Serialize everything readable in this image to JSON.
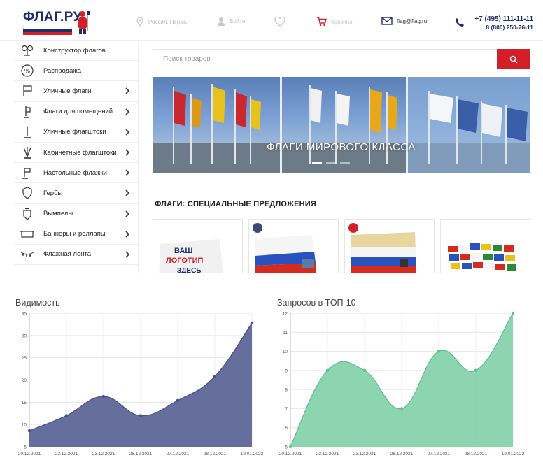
{
  "site": {
    "logo_text": "ФЛАГ.РУ",
    "location": "Россия, Пермь",
    "login": "Войти",
    "cart": "Корзина",
    "email": "flag@flag.ru",
    "phone1": "+7 (495) 111-11-11",
    "phone2": "8 (800) 250-76-11",
    "search_placeholder": "Поиск товаров",
    "banner_text": "ФЛАГИ МИРОВОГО КЛАССА",
    "offers_title": "ФЛАГИ: СПЕЦИАЛЬНЫЕ ПРЕДЛОЖЕНИЯ",
    "sidebar": [
      {
        "label": "Конструктор флагов",
        "icon": "flags-constructor-icon",
        "chevron": false
      },
      {
        "label": "Распродажа",
        "icon": "percent-icon",
        "chevron": false
      },
      {
        "label": "Уличные флаги",
        "icon": "street-flag-icon",
        "chevron": true
      },
      {
        "label": "Флаги для помещений",
        "icon": "indoor-flag-icon",
        "chevron": true
      },
      {
        "label": "Уличные флагштоки",
        "icon": "flagpole-icon",
        "chevron": true
      },
      {
        "label": "Кабинетные флагштоки",
        "icon": "office-flagpole-icon",
        "chevron": true
      },
      {
        "label": "Настольные флажки",
        "icon": "desk-flag-icon",
        "chevron": true
      },
      {
        "label": "Гербы",
        "icon": "shield-icon",
        "chevron": true
      },
      {
        "label": "Вымпелы",
        "icon": "pennant-icon",
        "chevron": true
      },
      {
        "label": "Баннеры и роллапы",
        "icon": "banner-icon",
        "chevron": true
      },
      {
        "label": "Флажная лента",
        "icon": "garland-icon",
        "chevron": true
      }
    ],
    "colors": {
      "brand_blue": "#1d2c6b",
      "accent_red": "#d31f2a"
    }
  },
  "chart_data": [
    {
      "type": "area",
      "title": "Видимость",
      "x": [
        "20.12.2021",
        "22.12.2021",
        "23.12.2021",
        "26.12.2021",
        "27.12.2021",
        "28.12.2021",
        "19.01.2022"
      ],
      "series": [
        {
          "values": [
            8.6,
            12,
            16.3,
            12,
            15.4,
            20.8,
            32.8
          ]
        }
      ],
      "ylim": [
        5,
        35
      ],
      "yticks": [
        5,
        10,
        15,
        20,
        25,
        30,
        35
      ],
      "grid": true,
      "fill_color": "#5e6699",
      "line_color": "#4a5187"
    },
    {
      "type": "area",
      "title": "Запросов в ТОП-10",
      "x": [
        "20.12.2021",
        "22.12.2021",
        "23.12.2021",
        "26.12.2021",
        "27.12.2021",
        "28.12.2021",
        "19.01.2022"
      ],
      "series": [
        {
          "values": [
            5,
            9,
            9,
            7,
            10,
            9,
            12
          ]
        }
      ],
      "ylim": [
        5,
        12
      ],
      "yticks": [
        5,
        6,
        7,
        8,
        9,
        10,
        11,
        12
      ],
      "grid": true,
      "fill_color": "#86d3ac",
      "line_color": "#5cc28f"
    }
  ]
}
